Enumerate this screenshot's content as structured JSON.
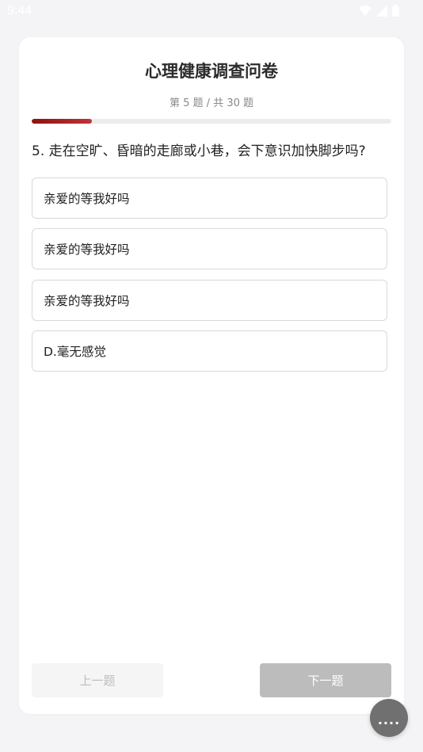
{
  "status_bar": {
    "time": "9:44",
    "icons": [
      "wifi-icon",
      "signal-icon",
      "battery-icon"
    ]
  },
  "survey": {
    "title": "心理健康调查问卷",
    "progress_text": "第 5 题 / 共 30 题",
    "progress_fraction": 0.1667,
    "progress_color": "#a81c22"
  },
  "question": {
    "text": "5. 走在空旷、昏暗的走廊或小巷，会下意识加快脚步吗?"
  },
  "options": [
    {
      "label": "亲爱的等我好吗"
    },
    {
      "label": "亲爱的等我好吗"
    },
    {
      "label": "亲爱的等我好吗"
    },
    {
      "label": "D.毫无感觉"
    }
  ],
  "navigation": {
    "prev_label": "上一题",
    "next_label": "下一题"
  },
  "fab": {
    "label": "...."
  }
}
